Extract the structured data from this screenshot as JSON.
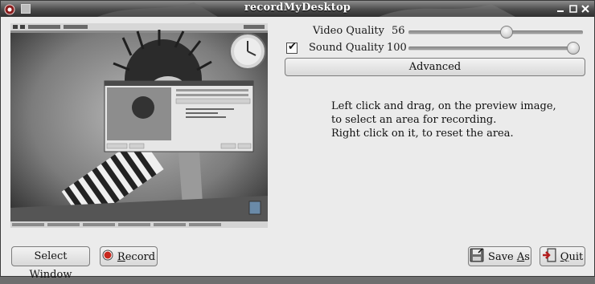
{
  "window": {
    "title": "recordMyDesktop"
  },
  "quality": {
    "video_label": "Video Quality",
    "video_value": "56",
    "video_level": 0.56,
    "sound_label": "Sound Quality",
    "sound_value": "100",
    "sound_level": 1.0,
    "sound_enabled": true
  },
  "buttons": {
    "advanced": "Advanced",
    "select_window": "Select Window",
    "record_prefix": "",
    "record_mnemonic": "R",
    "record_rest": "ecord",
    "save_prefix": "Save ",
    "save_mnemonic": "A",
    "save_rest": "s",
    "quit_prefix": "",
    "quit_mnemonic": "Q",
    "quit_rest": "uit"
  },
  "info": {
    "line1": "Left click and drag, on the preview image,",
    "line2": "to select an area for recording.",
    "line3": "Right click on it, to reset the area."
  },
  "icons": {
    "app": "recordmydesktop-icon",
    "record": "record-dot-icon",
    "save": "save-floppy-icon",
    "quit": "quit-exit-icon"
  },
  "colors": {
    "record_dot": "#c8281e",
    "titlebar": "#3a3a3a",
    "window_bg": "#ebebeb"
  }
}
